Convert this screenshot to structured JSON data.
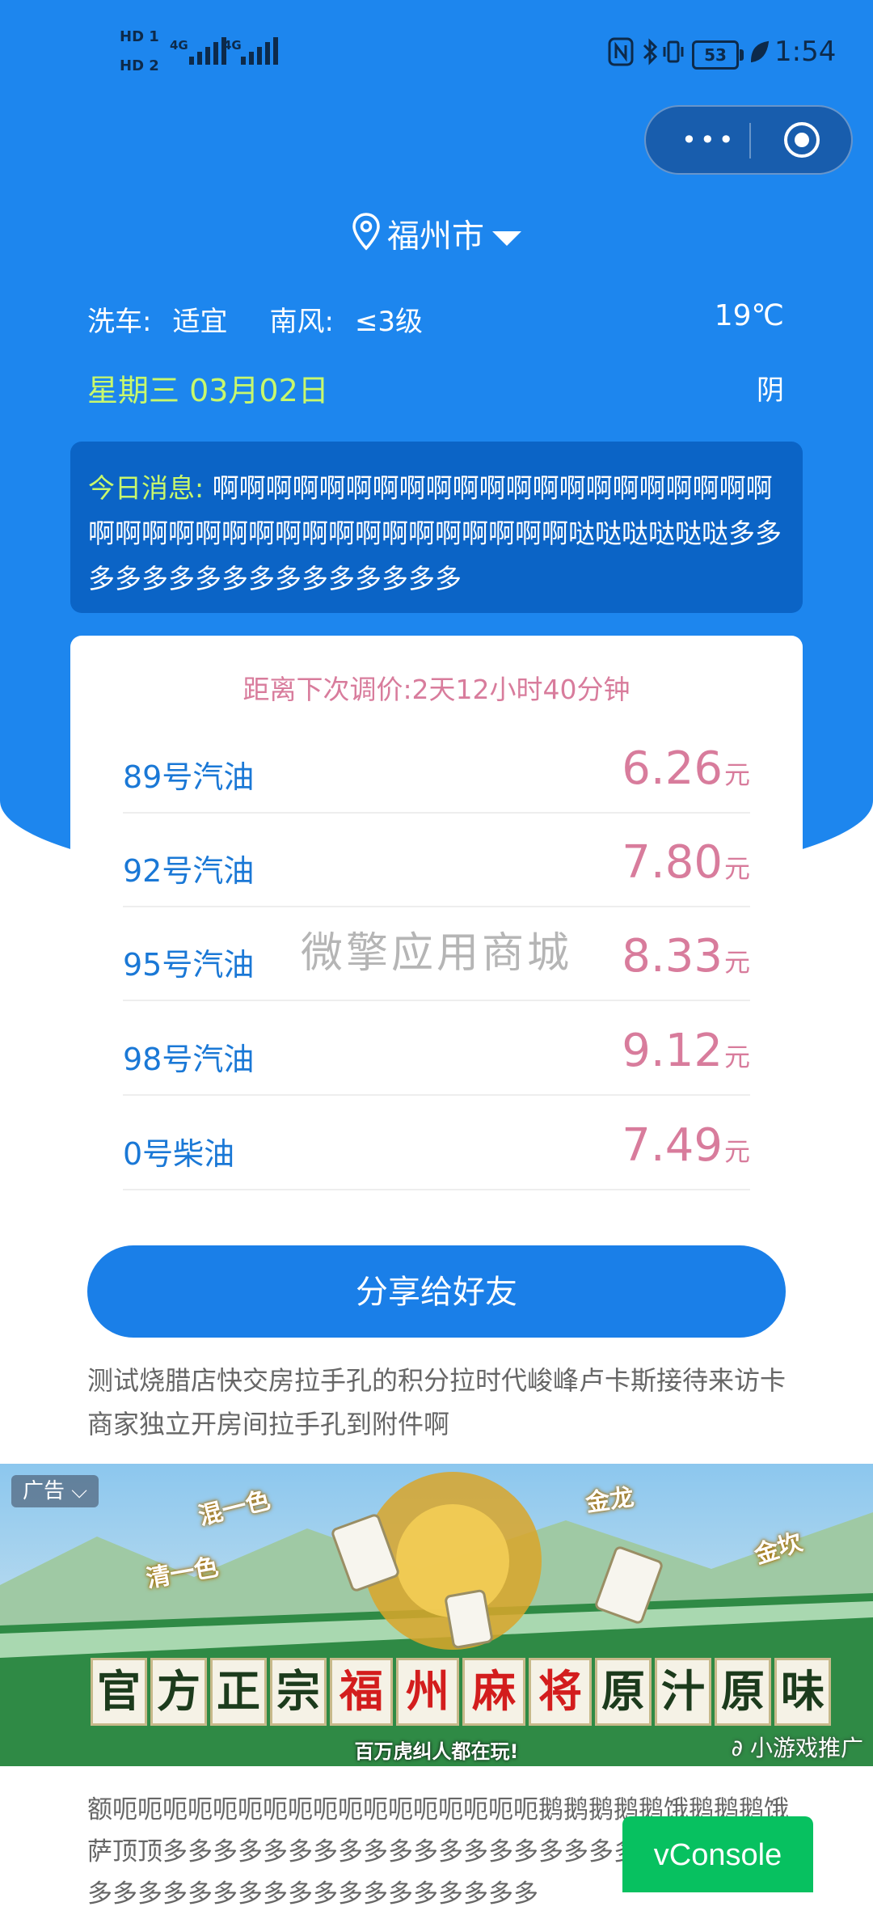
{
  "status": {
    "sim1": "HD 1",
    "sim2": "HD 2",
    "net1": "4G",
    "net2": "4G",
    "battery": "53",
    "time": "1:54"
  },
  "location": {
    "city": "福州市"
  },
  "weather": {
    "carwash_label": "洗车:",
    "carwash_value": "适宜",
    "wind_label": "南风:",
    "wind_value": "≤3级",
    "temperature": "19℃",
    "date": "星期三 03月02日",
    "condition": "阴"
  },
  "notice": {
    "label": "今日消息:",
    "text": "啊啊啊啊啊啊啊啊啊啊啊啊啊啊啊啊啊啊啊啊啊啊啊啊啊啊啊啊啊啊啊啊啊啊啊啊啊啊啊哒哒哒哒哒哒多多多多多多多多多多多多多多多多"
  },
  "prices": {
    "countdown": "距离下次调价:2天12小时40分钟",
    "unit": "元",
    "items": [
      {
        "name": "89号汽油",
        "price": "6.26"
      },
      {
        "name": "92号汽油",
        "price": "7.80"
      },
      {
        "name": "95号汽油",
        "price": "8.33"
      },
      {
        "name": "98号汽油",
        "price": "9.12"
      },
      {
        "name": "0号柴油",
        "price": "7.49"
      }
    ]
  },
  "watermark": "微擎应用商城",
  "share_label": "分享给好友",
  "description": "测试烧腊店快交房拉手孔的积分拉时代峻峰卢卡斯接待来访卡商家独立开房间拉手孔到附件啊",
  "ad": {
    "tag": "广告",
    "words": [
      "混一色",
      "清一色",
      "金龙",
      "金坎"
    ],
    "title_chars": [
      "官",
      "方",
      "正",
      "宗",
      "福",
      "州",
      "麻",
      "将",
      "原",
      "汁",
      "原",
      "味"
    ],
    "subtitle": "百万虎纠人都在玩!",
    "promo": "小游戏推广"
  },
  "long_text": "额呃呃呃呃呃呃呃呃呃呃呃呃呃呃呃呃呃鹅鹅鹅鹅鹅饿鹅鹅鹅饿萨顶顶多多多多多多多多多多多多多多多多多多多多多多多多多多多多多多多多多多多多多多多多多多多",
  "vconsole_label": "vConsole",
  "colors": {
    "primary": "#1d86ee",
    "accent_green": "#c8f86c",
    "price_pink": "#d87c9c",
    "fuel_blue": "#1a78d6",
    "vconsole_green": "#07c160"
  }
}
